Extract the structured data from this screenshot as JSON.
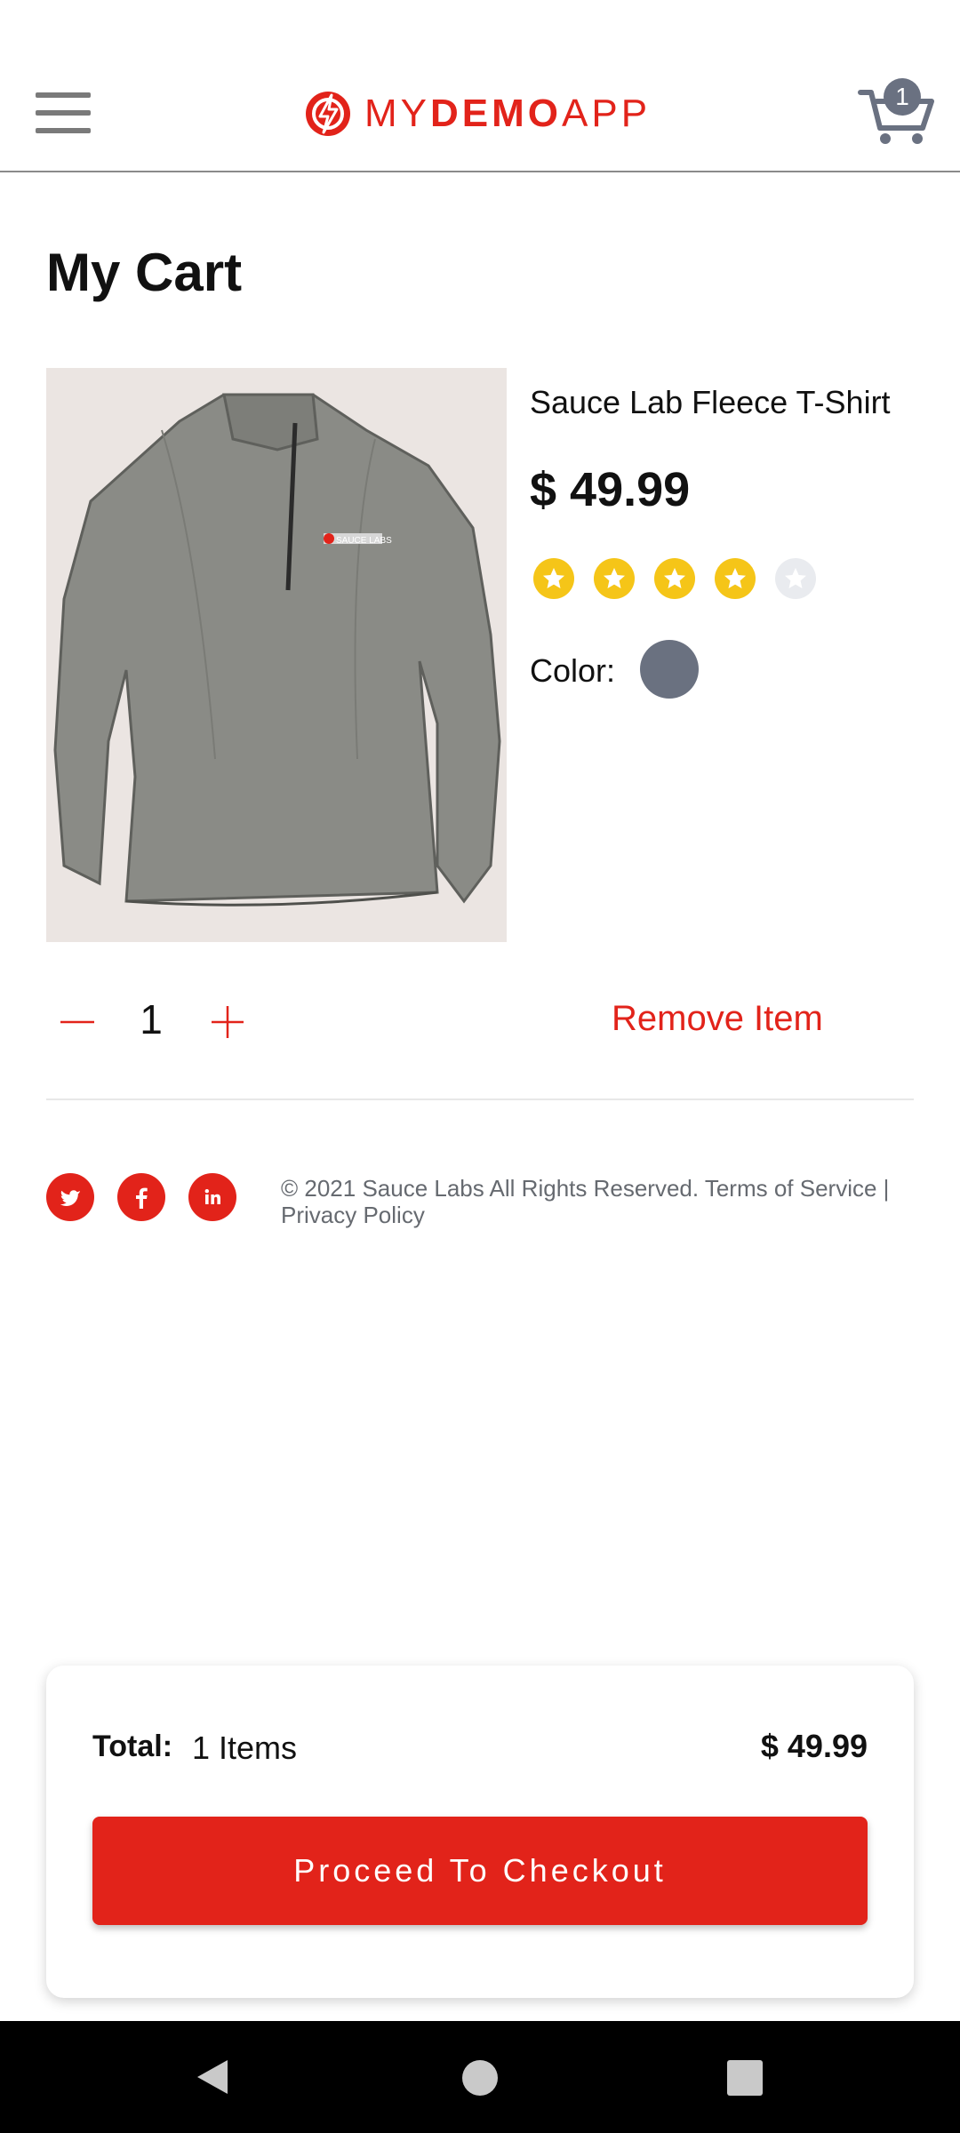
{
  "header": {
    "logo_text_light_1": "MY",
    "logo_text_bold": "DEMO",
    "logo_text_light_2": "APP",
    "cart_count": "1"
  },
  "page": {
    "title": "My Cart"
  },
  "product": {
    "name": "Sauce Lab Fleece T-Shirt",
    "price": "$ 49.99",
    "rating_stars": 4,
    "rating_max": 5,
    "color_label": "Color:",
    "color_value_hex": "#6a7180",
    "image_logo_text": "SAUCE LABS"
  },
  "quantity": {
    "value": "1"
  },
  "actions": {
    "remove_label": "Remove Item"
  },
  "footer": {
    "copyright": "© 2021 Sauce Labs All Rights Reserved. Terms of Service | Privacy Policy",
    "social": [
      "twitter-icon",
      "facebook-icon",
      "linkedin-icon"
    ]
  },
  "checkout": {
    "total_label": "Total:",
    "items_text": "1 Items",
    "total_price": "$ 49.99",
    "button_label": "Proceed To Checkout"
  },
  "colors": {
    "brand_red": "#e2231a",
    "star_gold": "#f5c518",
    "badge_gray": "#6a7181"
  }
}
